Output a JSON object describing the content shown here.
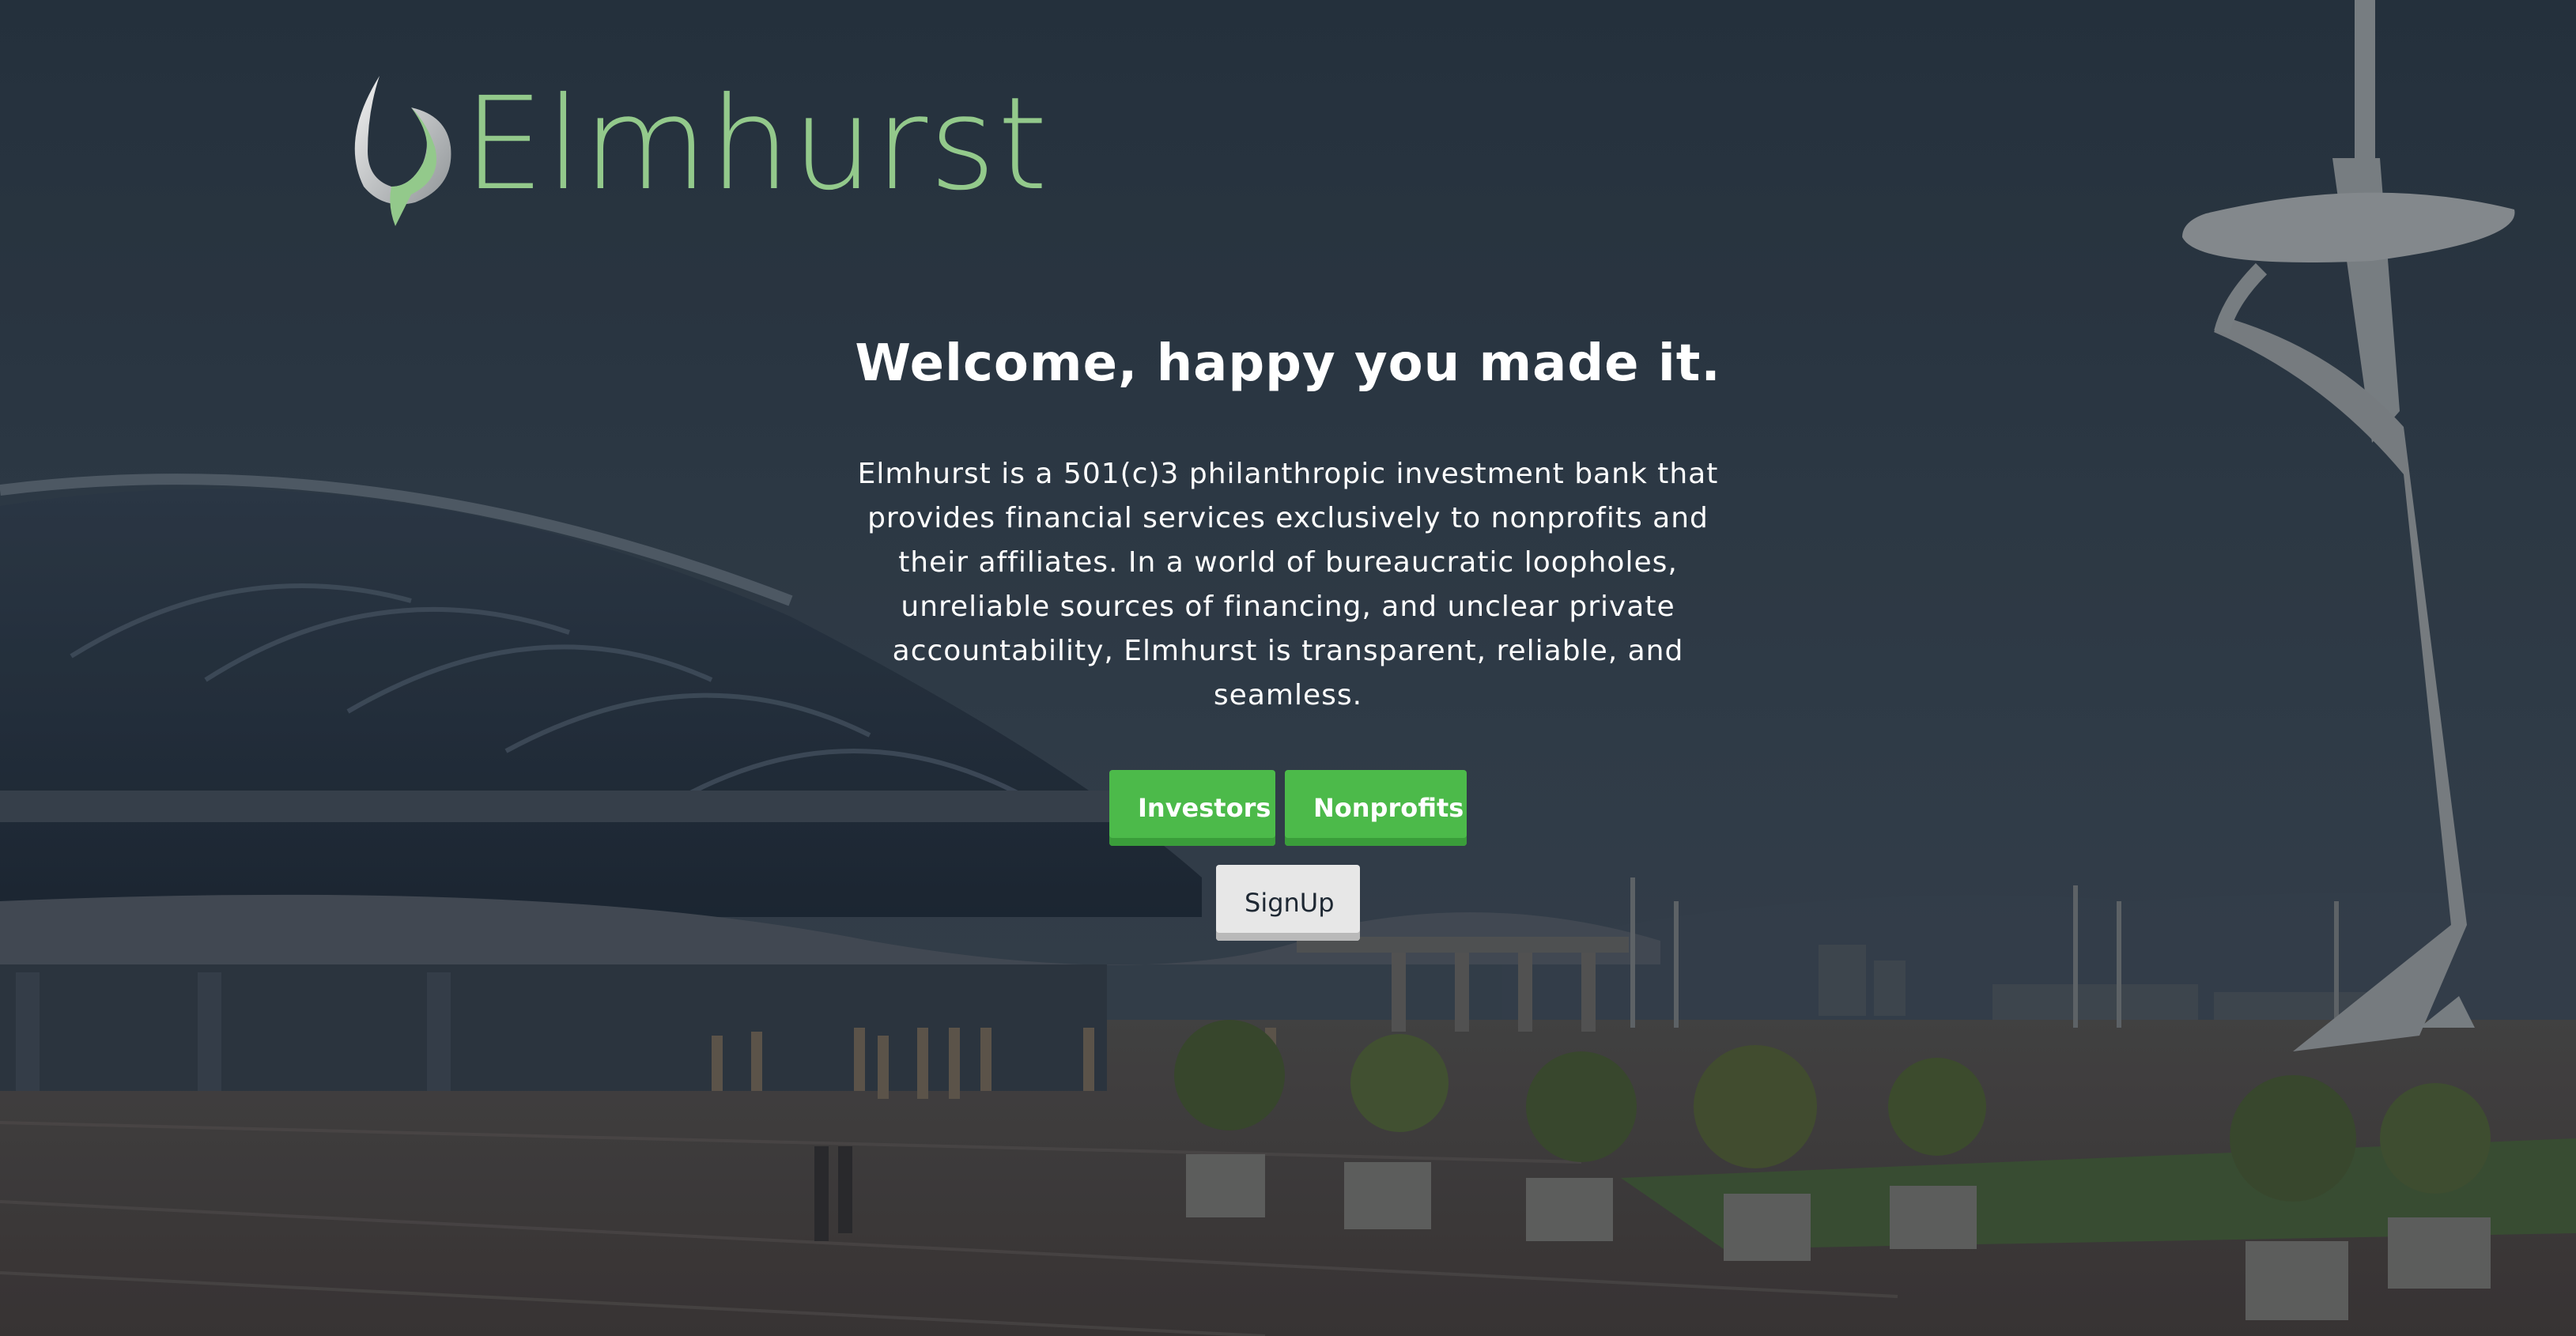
{
  "brand": {
    "name": "Elmhurst",
    "logo_color": "#93c98b"
  },
  "hero": {
    "title": "Welcome, happy you made it.",
    "description": "Elmhurst is a 501(c)3 philanthropic investment bank that provides financial services exclusively to nonprofits and their affiliates. In a world of bureaucratic loopholes, unreliable sources of financing, and unclear private accountability, Elmhurst is transparent, reliable, and seamless."
  },
  "buttons": {
    "investors_label": "Investors",
    "nonprofits_label": "Nonprofits",
    "signup_label": "SignUp"
  },
  "colors": {
    "accent_green": "#4cba4a",
    "signup_gray": "#e7e7e7",
    "text_white": "#ffffff"
  }
}
